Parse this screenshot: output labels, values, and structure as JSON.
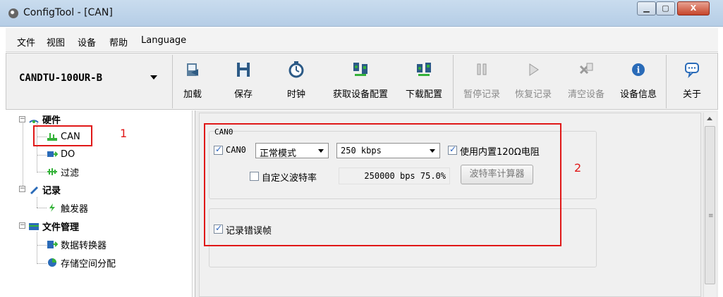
{
  "window": {
    "title": "ConfigTool - [CAN]"
  },
  "menu": [
    "文件",
    "视图",
    "设备",
    "帮助",
    "Language"
  ],
  "toolbar": {
    "device": "CANDTU-100UR-B",
    "buttons": [
      {
        "label": "加载",
        "icon": "load-icon",
        "disabled": false
      },
      {
        "label": "保存",
        "icon": "save-icon",
        "disabled": false
      },
      {
        "label": "时钟",
        "icon": "clock-icon",
        "disabled": false
      },
      {
        "label": "获取设备配置",
        "icon": "get-config-icon",
        "disabled": false
      },
      {
        "label": "下载配置",
        "icon": "download-config-icon",
        "disabled": false
      },
      {
        "label": "暂停记录",
        "icon": "pause-icon",
        "disabled": true
      },
      {
        "label": "恢复记录",
        "icon": "resume-icon",
        "disabled": true
      },
      {
        "label": "清空设备",
        "icon": "clear-icon",
        "disabled": true
      },
      {
        "label": "设备信息",
        "icon": "info-icon",
        "disabled": false
      },
      {
        "label": "关于",
        "icon": "about-icon",
        "disabled": false
      }
    ]
  },
  "tree": {
    "hardware": "硬件",
    "can": "CAN",
    "do": "DO",
    "filter": "过滤",
    "record": "记录",
    "trigger": "触发器",
    "file_mgmt": "文件管理",
    "converter": "数据转换器",
    "storage": "存储空间分配"
  },
  "annotations": {
    "one": "1",
    "two": "2"
  },
  "can_group": {
    "title": "CAN0",
    "enable_label": "CAN0",
    "mode": "正常模式",
    "baud": "250 kbps",
    "resistor_label": "使用内置120Ω电阻",
    "custom_baud_label": "自定义波特率",
    "baud_info": "250000 bps 75.0%",
    "calc_button": "波特率计算器"
  },
  "error_frame_label": "记录错误帧",
  "colors": {
    "annotation": "#e01818",
    "check": "#2a64c0"
  }
}
